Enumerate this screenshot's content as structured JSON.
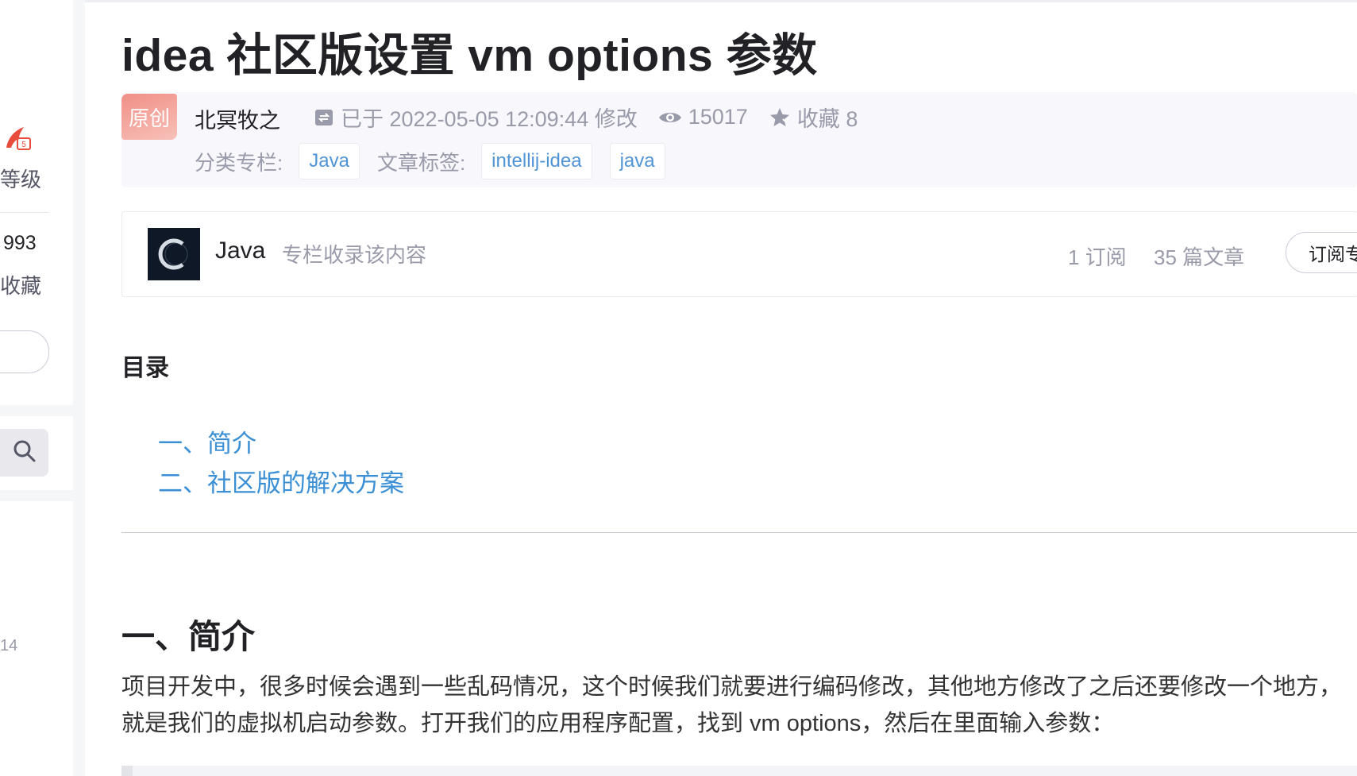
{
  "sidebar": {
    "level_label": "等级",
    "stat_value": "993",
    "fav_label": "收藏",
    "small_num": "14",
    "search_icon": "search-icon",
    "badge_icon": "writer-badge-icon"
  },
  "article": {
    "title": "idea 社区版设置 vm options 参数",
    "original_tag": "原创",
    "author": "北冥牧之",
    "modified_text": "已于 2022-05-05 12:09:44 修改",
    "views": "15017",
    "favorites": "收藏 8",
    "category_label": "分类专栏:",
    "categories": [
      "Java"
    ],
    "tags_label": "文章标签:",
    "tags": [
      "intellij-idea",
      "java"
    ]
  },
  "column": {
    "name": "Java",
    "description": "专栏收录该内容",
    "subscribers": "1 订阅",
    "articles": "35 篇文章",
    "subscribe_button": "订阅专栏"
  },
  "toc": {
    "title": "目录",
    "items": [
      "一、简介",
      "二、社区版的解决方案"
    ]
  },
  "section1": {
    "heading": "一、简介",
    "line1": "项目开发中，很多时候会遇到一些乱码情况，这个时候我们就要进行编码修改，其他地方修改了之后还要修改一个地方，",
    "line2": "就是我们的虚拟机启动参数。打开我们的应用程序配置，找到 vm options，然后在里面输入参数："
  },
  "colors": {
    "link": "#3b8fd5",
    "tag_text": "#5094d5",
    "original_tag": "#f08f86",
    "muted": "#999aaa"
  }
}
